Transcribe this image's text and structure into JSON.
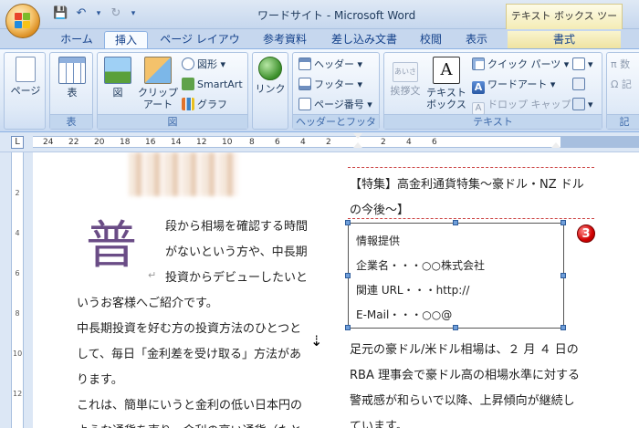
{
  "window": {
    "title": "ワードサイト - Microsoft Word",
    "context_tab_group": "テキスト ボックス ツール"
  },
  "qat": {
    "save": "💾",
    "undo": "↶",
    "undo_drop": "▾",
    "redo": "↻",
    "customize": "▾"
  },
  "tabs": [
    "ホーム",
    "挿入",
    "ページ レイアウト",
    "参考資料",
    "差し込み文書",
    "校閲",
    "表示",
    "書式"
  ],
  "active_tab": "挿入",
  "ribbon": {
    "pages": {
      "button": "ページ"
    },
    "table": {
      "button": "表",
      "group": "表"
    },
    "illustrations": {
      "picture": "図",
      "clipart_line1": "クリップ",
      "clipart_line2": "アート",
      "shapes": "図形",
      "smartart": "SmartArt",
      "chart": "グラフ",
      "group": "図"
    },
    "links": {
      "button": "リンク"
    },
    "header_footer": {
      "header": "ヘッダー",
      "footer": "フッター",
      "page_number": "ページ番号",
      "group": "ヘッダーとフッター"
    },
    "text": {
      "greeting_label": "挨拶文",
      "greeting_icon_text": "あいさつ",
      "textbox_line1": "テキスト",
      "textbox_line2": "ボックス",
      "quick_parts": "クイック パーツ",
      "wordart": "ワードアート",
      "dropcap": "ドロップ キャップ",
      "group": "テキスト"
    },
    "symbols": {
      "equation": "π 数",
      "symbol": "Ω 記",
      "group": "記"
    }
  },
  "ruler": {
    "selector": "L",
    "numbers": [
      "24",
      "22",
      "20",
      "18",
      "16",
      "14",
      "12",
      "10",
      "8",
      "6",
      "4",
      "2",
      "2",
      "4",
      "6"
    ]
  },
  "vruler": {
    "numbers": [
      "2",
      "4",
      "6",
      "8",
      "10",
      "12"
    ]
  },
  "document": {
    "dropcap": "普",
    "left": [
      "段から相場を確認する時間",
      "がないという方や、中長期",
      "投資からデビューしたいと",
      "いうお客様へご紹介です。",
      "中長期投資を好む方の投資方法のひとつと",
      "して、毎日「金利差を受け取る」方法があ",
      "ります。",
      "これは、簡単にいうと金利の低い日本円の",
      "ような通貨を売り、金利の高い通貨（たと"
    ],
    "right_title": [
      "【特集】高金利通貨特集～豪ドル・NZ ドル",
      "の今後～】"
    ],
    "textbox": [
      "情報提供",
      "企業名・・・○○株式会社",
      "関連 URL・・・http://",
      "E-Mail・・・○○@"
    ],
    "right_body": [
      "足元の豪ドル/米ドル相場は、２ 月 ４ 日の",
      "RBA 理事会で豪ドル高の相場水準に対する",
      "警戒感が和らいで以降、上昇傾向が継続し",
      "ています。"
    ],
    "paragraph_mark": "↵",
    "badge": "3"
  }
}
